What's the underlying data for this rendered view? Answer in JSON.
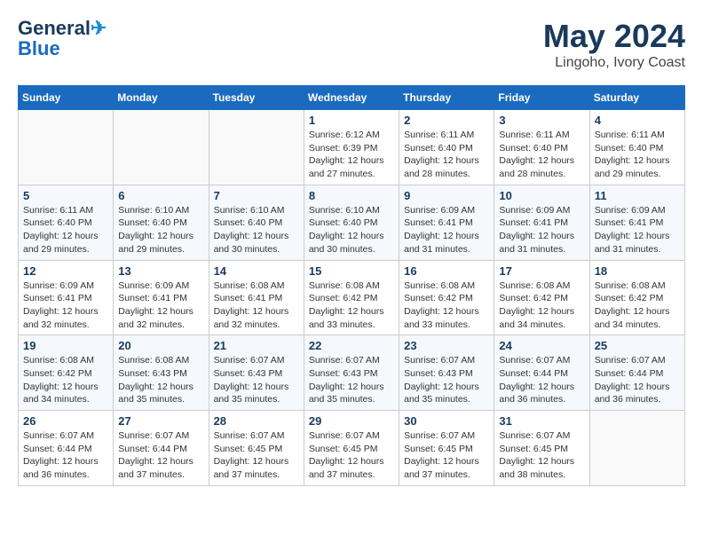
{
  "header": {
    "logo_line1": "General",
    "logo_line2": "Blue",
    "month_year": "May 2024",
    "location": "Lingoho, Ivory Coast"
  },
  "weekdays": [
    "Sunday",
    "Monday",
    "Tuesday",
    "Wednesday",
    "Thursday",
    "Friday",
    "Saturday"
  ],
  "weeks": [
    [
      {
        "day": "",
        "info": ""
      },
      {
        "day": "",
        "info": ""
      },
      {
        "day": "",
        "info": ""
      },
      {
        "day": "1",
        "info": "Sunrise: 6:12 AM\nSunset: 6:39 PM\nDaylight: 12 hours\nand 27 minutes."
      },
      {
        "day": "2",
        "info": "Sunrise: 6:11 AM\nSunset: 6:40 PM\nDaylight: 12 hours\nand 28 minutes."
      },
      {
        "day": "3",
        "info": "Sunrise: 6:11 AM\nSunset: 6:40 PM\nDaylight: 12 hours\nand 28 minutes."
      },
      {
        "day": "4",
        "info": "Sunrise: 6:11 AM\nSunset: 6:40 PM\nDaylight: 12 hours\nand 29 minutes."
      }
    ],
    [
      {
        "day": "5",
        "info": "Sunrise: 6:11 AM\nSunset: 6:40 PM\nDaylight: 12 hours\nand 29 minutes."
      },
      {
        "day": "6",
        "info": "Sunrise: 6:10 AM\nSunset: 6:40 PM\nDaylight: 12 hours\nand 29 minutes."
      },
      {
        "day": "7",
        "info": "Sunrise: 6:10 AM\nSunset: 6:40 PM\nDaylight: 12 hours\nand 30 minutes."
      },
      {
        "day": "8",
        "info": "Sunrise: 6:10 AM\nSunset: 6:40 PM\nDaylight: 12 hours\nand 30 minutes."
      },
      {
        "day": "9",
        "info": "Sunrise: 6:09 AM\nSunset: 6:41 PM\nDaylight: 12 hours\nand 31 minutes."
      },
      {
        "day": "10",
        "info": "Sunrise: 6:09 AM\nSunset: 6:41 PM\nDaylight: 12 hours\nand 31 minutes."
      },
      {
        "day": "11",
        "info": "Sunrise: 6:09 AM\nSunset: 6:41 PM\nDaylight: 12 hours\nand 31 minutes."
      }
    ],
    [
      {
        "day": "12",
        "info": "Sunrise: 6:09 AM\nSunset: 6:41 PM\nDaylight: 12 hours\nand 32 minutes."
      },
      {
        "day": "13",
        "info": "Sunrise: 6:09 AM\nSunset: 6:41 PM\nDaylight: 12 hours\nand 32 minutes."
      },
      {
        "day": "14",
        "info": "Sunrise: 6:08 AM\nSunset: 6:41 PM\nDaylight: 12 hours\nand 32 minutes."
      },
      {
        "day": "15",
        "info": "Sunrise: 6:08 AM\nSunset: 6:42 PM\nDaylight: 12 hours\nand 33 minutes."
      },
      {
        "day": "16",
        "info": "Sunrise: 6:08 AM\nSunset: 6:42 PM\nDaylight: 12 hours\nand 33 minutes."
      },
      {
        "day": "17",
        "info": "Sunrise: 6:08 AM\nSunset: 6:42 PM\nDaylight: 12 hours\nand 34 minutes."
      },
      {
        "day": "18",
        "info": "Sunrise: 6:08 AM\nSunset: 6:42 PM\nDaylight: 12 hours\nand 34 minutes."
      }
    ],
    [
      {
        "day": "19",
        "info": "Sunrise: 6:08 AM\nSunset: 6:42 PM\nDaylight: 12 hours\nand 34 minutes."
      },
      {
        "day": "20",
        "info": "Sunrise: 6:08 AM\nSunset: 6:43 PM\nDaylight: 12 hours\nand 35 minutes."
      },
      {
        "day": "21",
        "info": "Sunrise: 6:07 AM\nSunset: 6:43 PM\nDaylight: 12 hours\nand 35 minutes."
      },
      {
        "day": "22",
        "info": "Sunrise: 6:07 AM\nSunset: 6:43 PM\nDaylight: 12 hours\nand 35 minutes."
      },
      {
        "day": "23",
        "info": "Sunrise: 6:07 AM\nSunset: 6:43 PM\nDaylight: 12 hours\nand 35 minutes."
      },
      {
        "day": "24",
        "info": "Sunrise: 6:07 AM\nSunset: 6:44 PM\nDaylight: 12 hours\nand 36 minutes."
      },
      {
        "day": "25",
        "info": "Sunrise: 6:07 AM\nSunset: 6:44 PM\nDaylight: 12 hours\nand 36 minutes."
      }
    ],
    [
      {
        "day": "26",
        "info": "Sunrise: 6:07 AM\nSunset: 6:44 PM\nDaylight: 12 hours\nand 36 minutes."
      },
      {
        "day": "27",
        "info": "Sunrise: 6:07 AM\nSunset: 6:44 PM\nDaylight: 12 hours\nand 37 minutes."
      },
      {
        "day": "28",
        "info": "Sunrise: 6:07 AM\nSunset: 6:45 PM\nDaylight: 12 hours\nand 37 minutes."
      },
      {
        "day": "29",
        "info": "Sunrise: 6:07 AM\nSunset: 6:45 PM\nDaylight: 12 hours\nand 37 minutes."
      },
      {
        "day": "30",
        "info": "Sunrise: 6:07 AM\nSunset: 6:45 PM\nDaylight: 12 hours\nand 37 minutes."
      },
      {
        "day": "31",
        "info": "Sunrise: 6:07 AM\nSunset: 6:45 PM\nDaylight: 12 hours\nand 38 minutes."
      },
      {
        "day": "",
        "info": ""
      }
    ]
  ]
}
